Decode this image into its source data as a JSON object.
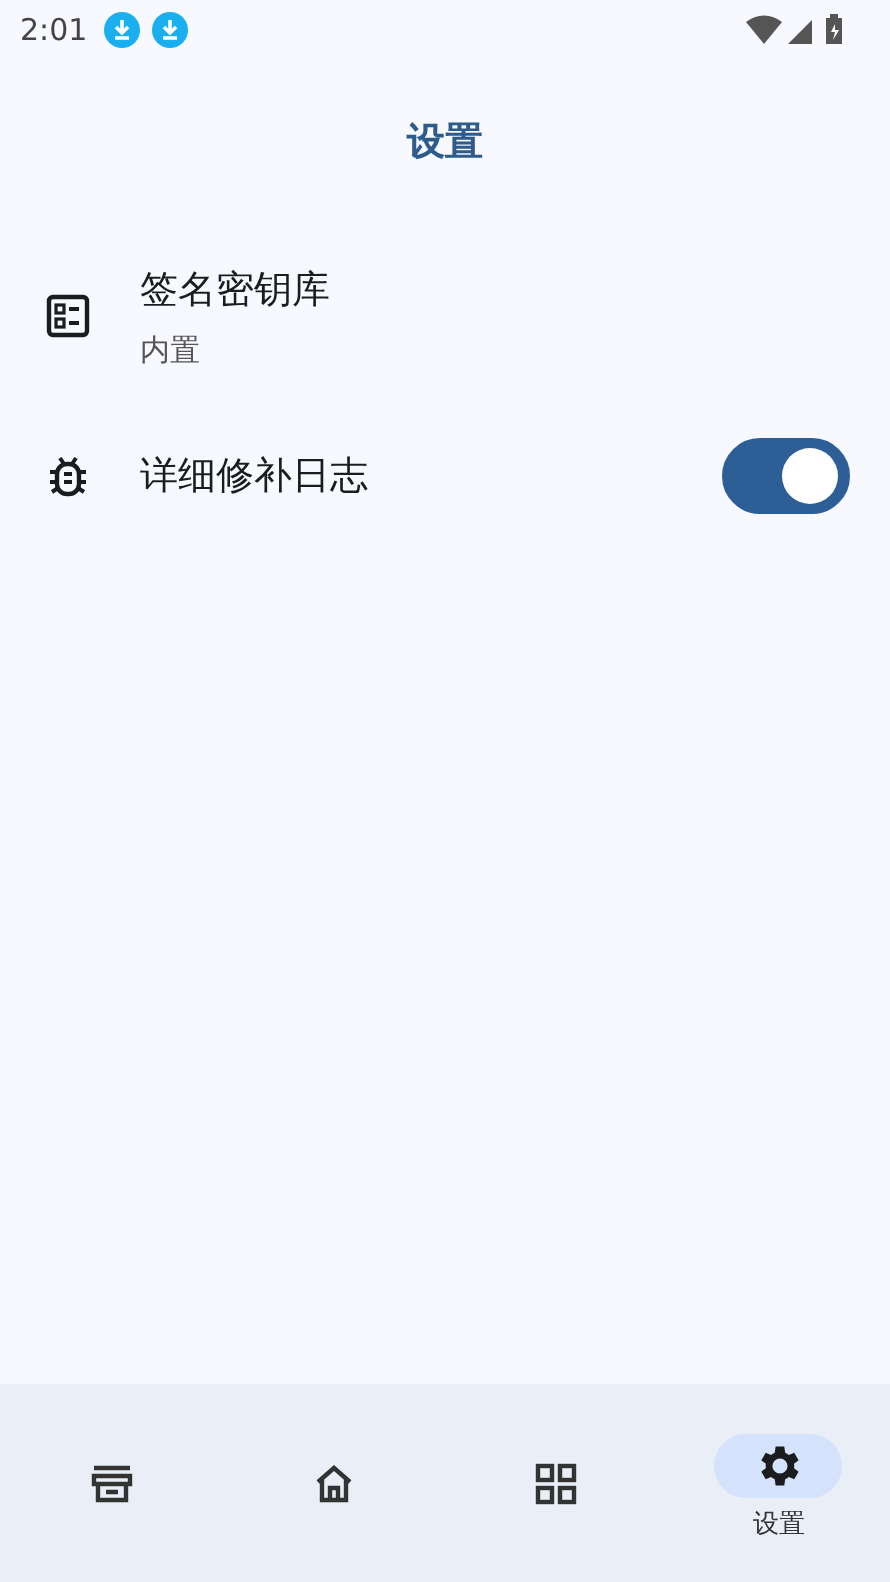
{
  "status_bar": {
    "time": "2:01",
    "notifications": [
      {
        "kind": "download"
      },
      {
        "kind": "download"
      }
    ]
  },
  "header": {
    "title": "设置"
  },
  "settings": [
    {
      "kind": "link",
      "title": "签名密钥库",
      "subtitle": "内置"
    },
    {
      "kind": "toggle",
      "title": "详细修补日志",
      "on": true
    }
  ],
  "bottom_nav": [
    {
      "selected": false
    },
    {
      "selected": false
    },
    {
      "selected": false
    },
    {
      "label": "设置",
      "selected": true
    }
  ]
}
